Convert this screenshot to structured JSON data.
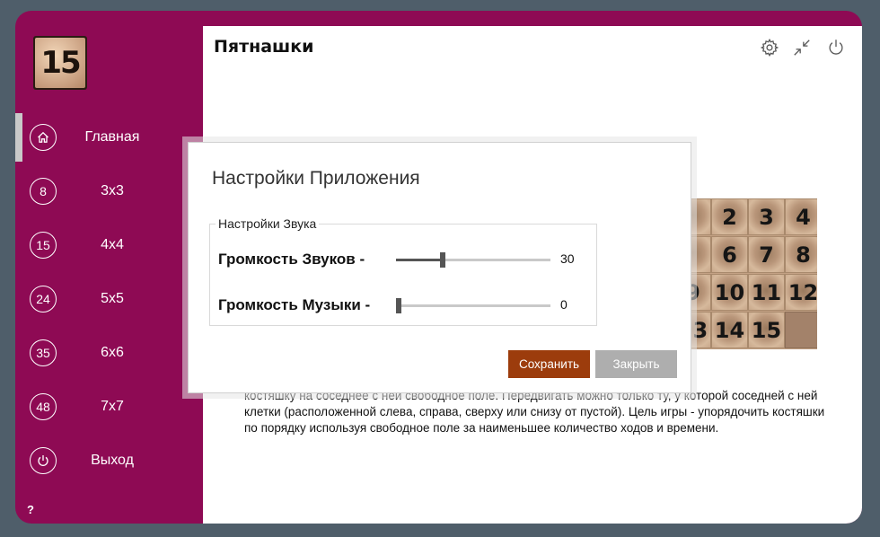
{
  "app": {
    "title": "Пятнашки",
    "logo_text": "15"
  },
  "sidebar": {
    "items": [
      {
        "badge": "",
        "icon": "home-icon",
        "label": "Главная"
      },
      {
        "badge": "8",
        "label": "3x3"
      },
      {
        "badge": "15",
        "label": "4x4"
      },
      {
        "badge": "24",
        "label": "5x5"
      },
      {
        "badge": "35",
        "label": "6x6"
      },
      {
        "badge": "48",
        "label": "7x7"
      },
      {
        "badge": "",
        "icon": "power-icon",
        "label": "Выход"
      }
    ],
    "help": "?"
  },
  "toolbar": {
    "icons": [
      "gear-icon",
      "compress-icon",
      "power-icon"
    ]
  },
  "board": {
    "visible_tiles": [
      [
        "",
        "2",
        "3",
        "4"
      ],
      [
        "",
        "6",
        "7",
        "8"
      ],
      [
        "9",
        "10",
        "11",
        "12"
      ],
      [
        "13",
        "14",
        "15",
        ""
      ]
    ]
  },
  "description": "костяшку на соседнее с ней свободное поле. Передвигать можно только ту, у которой соседней с ней клетки (расположенной слева, справа, сверху или снизу от пустой). Цель игры - упорядочить костяшки по порядку используя свободное поле за наименьшее количество ходов и времени.",
  "dialog": {
    "title": "Настройки Приложения",
    "group_title": "Настройки Звука",
    "sound": {
      "label": "Громкость Звуков -",
      "value": "30",
      "fraction": 0.3
    },
    "music": {
      "label": "Громкость Музыки -",
      "value": "0",
      "fraction": 0
    },
    "save_label": "Сохранить",
    "close_label": "Закрыть"
  },
  "colors": {
    "sidebar": "#8e0a54",
    "background": "#4f5e6a",
    "save_button": "#9c3c0c",
    "close_button": "#aeaeae"
  }
}
